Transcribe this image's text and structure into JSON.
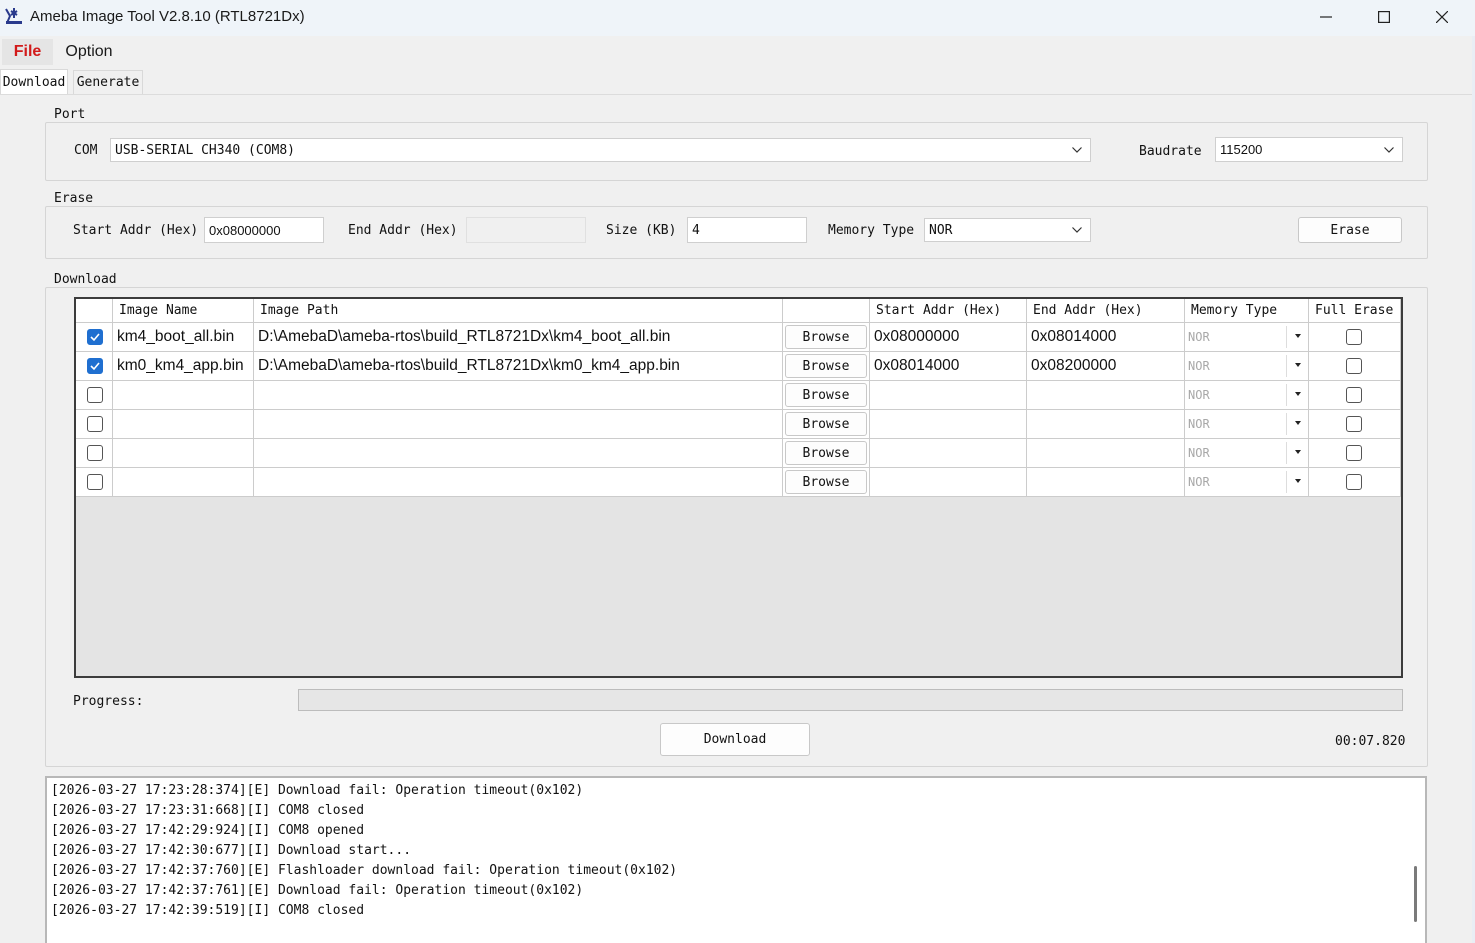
{
  "window": {
    "title": "Ameba Image Tool V2.8.10 (RTL8721Dx)",
    "logo_icon": "ameba-logo-icon",
    "controls": [
      "minimize-icon",
      "maximize-icon",
      "close-icon"
    ]
  },
  "menu": {
    "file": "File",
    "option": "Option"
  },
  "tabs": {
    "download": "Download",
    "generate": "Generate"
  },
  "port": {
    "group_title": "Port",
    "com_label": "COM",
    "com_value": "USB-SERIAL CH340 (COM8)",
    "baudrate_label": "Baudrate",
    "baudrate_value": "115200"
  },
  "erase": {
    "group_title": "Erase",
    "start_label": "Start Addr (Hex)",
    "start_value": "0x08000000",
    "end_label": "End Addr (Hex)",
    "end_value": "",
    "size_label": "Size (KB)",
    "size_value": "4",
    "memory_label": "Memory Type",
    "memory_value": "NOR",
    "erase_button": "Erase"
  },
  "download": {
    "group_title": "Download",
    "columns": {
      "image_name": "Image Name",
      "image_path": "Image Path",
      "start_addr": "Start Addr (Hex)",
      "end_addr": "End Addr (Hex)",
      "memory_type": "Memory Type",
      "full_erase": "Full Erase"
    },
    "browse_label": "Browse",
    "rows": [
      {
        "checked": true,
        "name": "km4_boot_all.bin",
        "path": "D:\\AmebaD\\ameba-rtos\\build_RTL8721Dx\\km4_boot_all.bin",
        "start": "0x08000000",
        "end": "0x08014000",
        "mem": "NOR",
        "full_erase": false
      },
      {
        "checked": true,
        "name": "km0_km4_app.bin",
        "path": "D:\\AmebaD\\ameba-rtos\\build_RTL8721Dx\\km0_km4_app.bin",
        "start": "0x08014000",
        "end": "0x08200000",
        "mem": "NOR",
        "full_erase": false
      },
      {
        "checked": false,
        "name": "",
        "path": "",
        "start": "",
        "end": "",
        "mem": "NOR",
        "full_erase": false
      },
      {
        "checked": false,
        "name": "",
        "path": "",
        "start": "",
        "end": "",
        "mem": "NOR",
        "full_erase": false
      },
      {
        "checked": false,
        "name": "",
        "path": "",
        "start": "",
        "end": "",
        "mem": "NOR",
        "full_erase": false
      },
      {
        "checked": false,
        "name": "",
        "path": "",
        "start": "",
        "end": "",
        "mem": "NOR",
        "full_erase": false
      }
    ],
    "progress_label": "Progress:",
    "progress_fraction": 0,
    "download_button": "Download",
    "elapsed": "00:07.820"
  },
  "log": [
    "[2026-03-27 17:23:28:374][E] Download fail: Operation timeout(0x102)",
    "[2026-03-27 17:23:31:668][I] COM8 closed",
    "[2026-03-27 17:42:29:924][I] COM8 opened",
    "[2026-03-27 17:42:30:677][I] Download start...",
    "[2026-03-27 17:42:37:760][E] Flashloader download fail: Operation timeout(0x102)",
    "[2026-03-27 17:42:37:761][E] Download fail: Operation timeout(0x102)",
    "[2026-03-27 17:42:39:519][I] COM8 closed"
  ],
  "colors": {
    "file_menu_text": "#d21a1a",
    "checkbox_checked": "#1f6fd0",
    "titlebar_bg": "#eff4f9"
  }
}
